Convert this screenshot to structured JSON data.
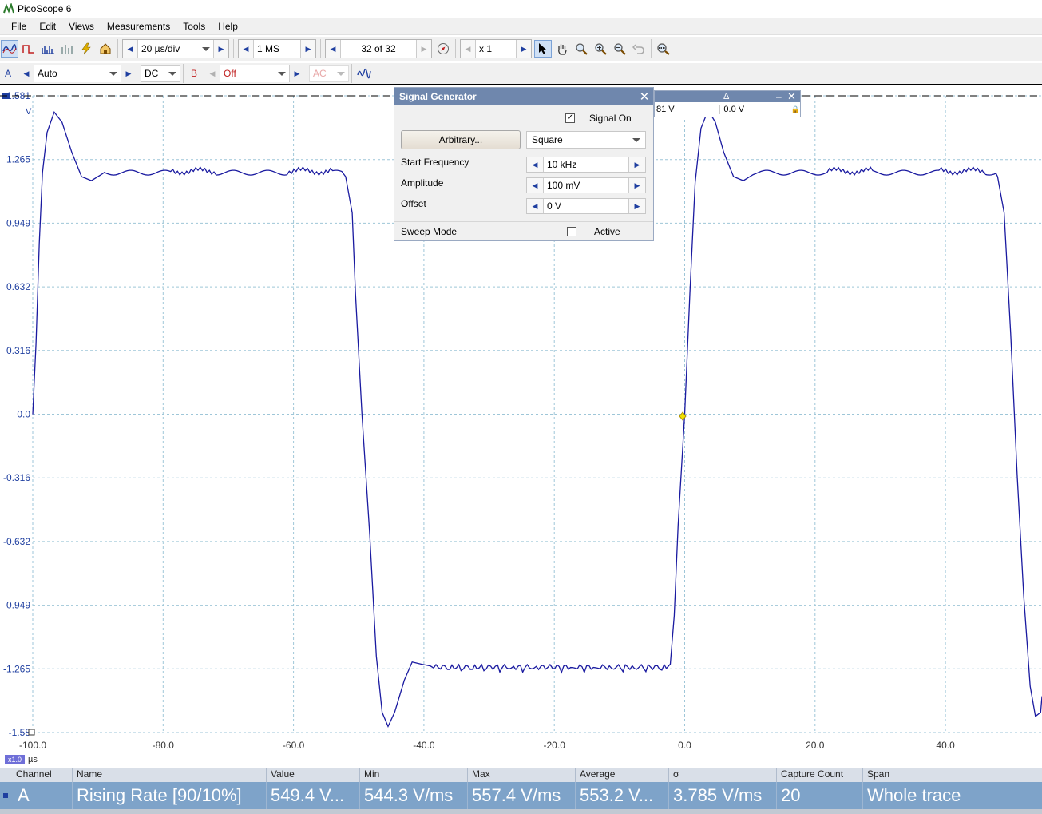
{
  "window": {
    "title": "PicoScope 6"
  },
  "menu": [
    {
      "label": "File",
      "key": "F"
    },
    {
      "label": "Edit",
      "key": "E"
    },
    {
      "label": "Views",
      "key": "V"
    },
    {
      "label": "Measurements",
      "key": "M"
    },
    {
      "label": "Tools",
      "key": "T"
    },
    {
      "label": "Help",
      "key": "H"
    }
  ],
  "toolbar": {
    "timebase": "20 µs/div",
    "samples": "1 MS",
    "buffer": "32 of 32",
    "zoom": "x 1"
  },
  "channel_bar": {
    "channel_a_label": "A",
    "channel_a_range": "Auto",
    "channel_a_coupling": "DC",
    "channel_b_label": "B",
    "channel_b_range": "Off",
    "channel_b_coupling": "AC"
  },
  "scope": {
    "y_unit": "V",
    "y_ticks": [
      "1.581",
      "1.265",
      "0.949",
      "0.632",
      "0.316",
      "0.0",
      "-0.316",
      "-0.632",
      "-0.949",
      "-1.265",
      "-1.58"
    ],
    "x_ticks": [
      "-100.0",
      "-80.0",
      "-60.0",
      "-40.0",
      "-20.0",
      "0.0",
      "20.0",
      "40.0"
    ],
    "x_unit": "µs",
    "zoom_badge": "x1.0",
    "trace_color": "#1a1aa0"
  },
  "signal_generator": {
    "title": "Signal Generator",
    "signal_on_label": "Signal On",
    "signal_on_checked": true,
    "arbitrary_button": "Arbitrary...",
    "waveform": "Square",
    "start_frequency_label": "Start Frequency",
    "start_frequency": "10 kHz",
    "amplitude_label": "Amplitude",
    "amplitude": "100 mV",
    "offset_label": "Offset",
    "offset": "0 V",
    "sweep_mode_label": "Sweep Mode",
    "active_label": "Active",
    "active_checked": false
  },
  "ruler_panel": {
    "delta_symbol": "Δ",
    "value_1": "81 V",
    "value_delta": "0.0 V"
  },
  "measurements": {
    "headers": [
      "Channel",
      "Name",
      "Value",
      "Min",
      "Max",
      "Average",
      "σ",
      "Capture Count",
      "Span"
    ],
    "row": [
      "A",
      "Rising Rate  [90/10%]",
      "549.4 V...",
      "544.3 V/ms",
      "557.4 V/ms",
      "553.2 V...",
      "3.785 V/ms",
      "20",
      "Whole trace"
    ]
  }
}
